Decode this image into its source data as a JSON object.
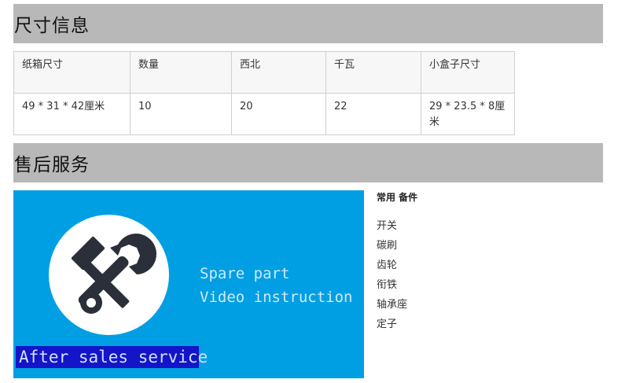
{
  "sections": {
    "size_title": "尺寸信息",
    "service_title": "售后服务"
  },
  "spec_table": {
    "headers": [
      "纸箱尺寸",
      "数量",
      "西北",
      "千瓦",
      "小盒子尺寸"
    ],
    "row": [
      "49 * 31 * 42厘米",
      "10",
      "20",
      "22",
      "29 * 23.5 * 8厘米"
    ]
  },
  "banner": {
    "line1": "Spare part",
    "line2": "Video instruction",
    "footer": "After sales service",
    "icon": "tools-icon",
    "colors": {
      "background": "#009fe3",
      "footer_box": "#1414c8"
    }
  },
  "parts": {
    "title": "常用 备件",
    "items": [
      "开关",
      "碳刷",
      "齿轮",
      "衔铁",
      "轴承座",
      "定子"
    ]
  }
}
